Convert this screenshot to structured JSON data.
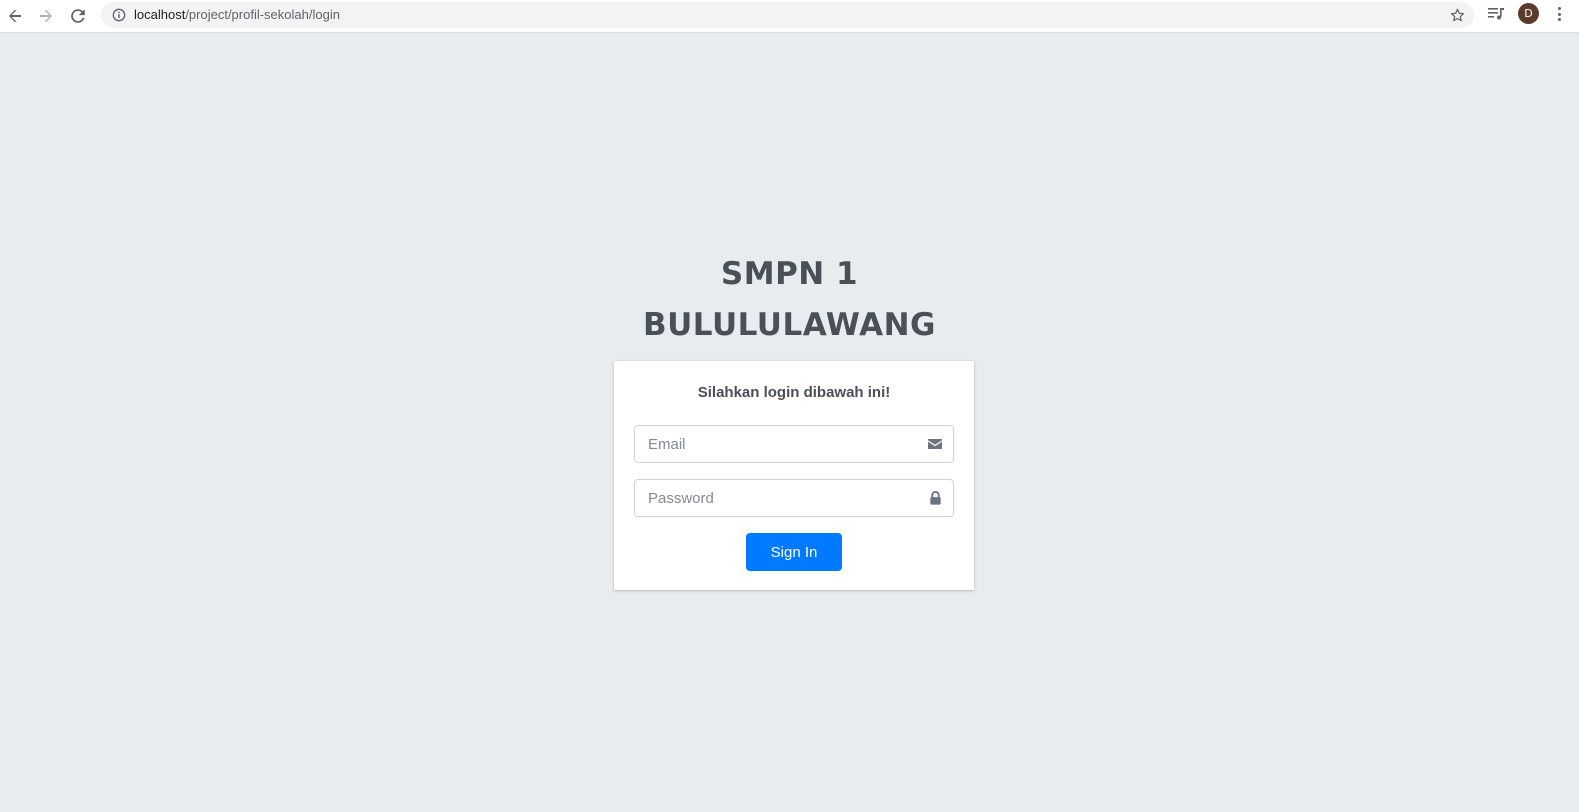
{
  "browser": {
    "url_host": "localhost",
    "url_path": "/project/profil-sekolah/login",
    "avatar_letter": "D",
    "icons": {
      "back": "back-arrow-icon",
      "forward": "forward-arrow-icon",
      "reload": "reload-icon",
      "site_info": "info-icon",
      "bookmark": "star-icon",
      "media": "media-queue-icon",
      "menu": "kebab-menu-icon"
    }
  },
  "login": {
    "brand_line1": "SMPN 1",
    "brand_line2": "BULULULAWANG",
    "message": "Silahkan login dibawah ini!",
    "email_placeholder": "Email",
    "email_value": "",
    "password_placeholder": "Password",
    "password_value": "",
    "signin_label": "Sign In",
    "icons": {
      "email": "envelope-icon",
      "password": "lock-icon"
    }
  },
  "colors": {
    "page_background": "#e9ecef",
    "brand_text": "#495057",
    "primary_button": "#007bff",
    "avatar_background": "#5d3a2e"
  }
}
